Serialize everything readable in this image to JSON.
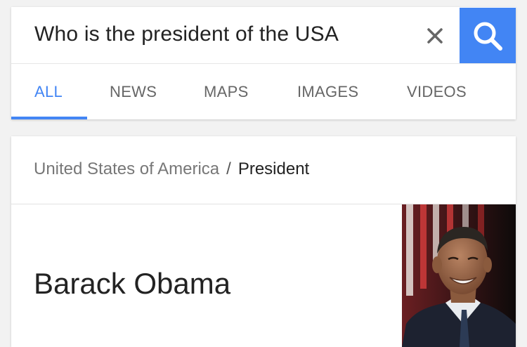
{
  "search": {
    "query": "Who is the president of the USA",
    "clear_icon": "close-icon",
    "search_icon": "search-icon",
    "accent_color": "#4285f4"
  },
  "tabs": [
    {
      "label": "ALL",
      "active": true
    },
    {
      "label": "NEWS",
      "active": false
    },
    {
      "label": "MAPS",
      "active": false
    },
    {
      "label": "IMAGES",
      "active": false
    },
    {
      "label": "VIDEOS",
      "active": false
    }
  ],
  "result": {
    "breadcrumb_parent": "United States of America",
    "breadcrumb_separator": "/",
    "breadcrumb_current": "President",
    "answer": "Barack Obama",
    "photo": "portrait-photo"
  }
}
